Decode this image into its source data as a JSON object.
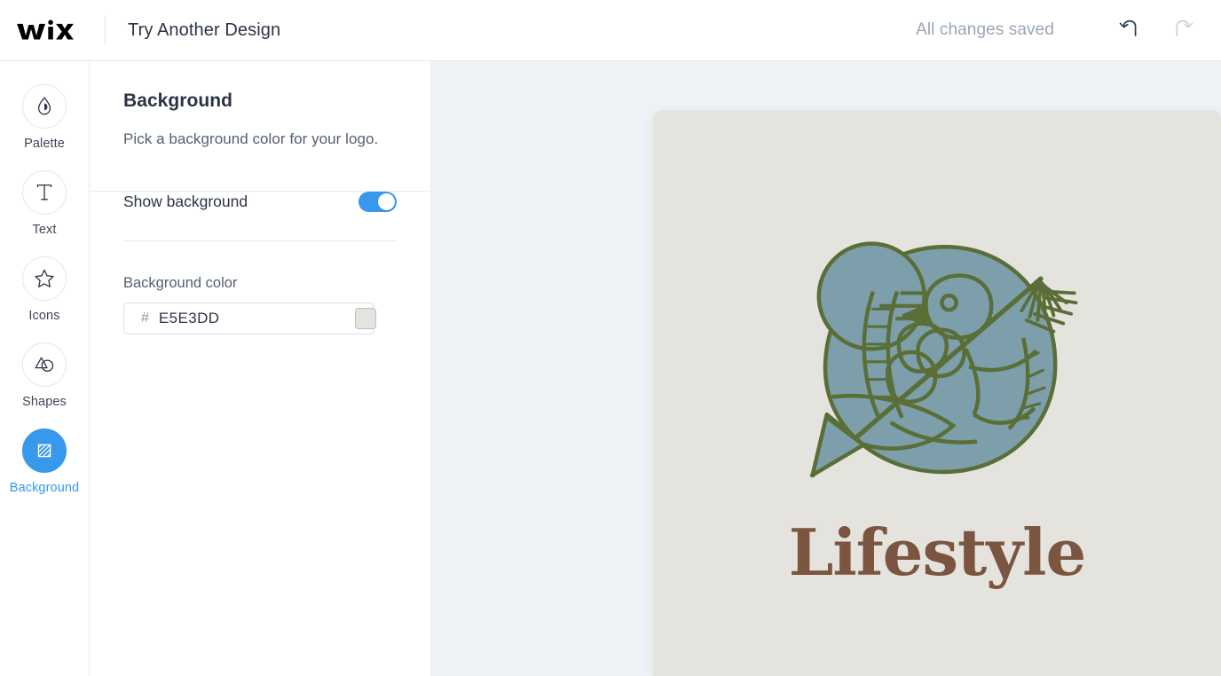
{
  "topbar": {
    "brand": "WiX",
    "title": "Try Another Design",
    "save_status": "All changes saved",
    "undo_label": "Undo",
    "redo_label": "Redo"
  },
  "sidebar": {
    "items": [
      {
        "id": "palette",
        "label": "Palette",
        "icon": "droplet-icon",
        "active": false
      },
      {
        "id": "text",
        "label": "Text",
        "icon": "text-t-icon",
        "active": false
      },
      {
        "id": "icons",
        "label": "Icons",
        "icon": "star-icon",
        "active": false
      },
      {
        "id": "shapes",
        "label": "Shapes",
        "icon": "shapes-icon",
        "active": false
      },
      {
        "id": "background",
        "label": "Background",
        "icon": "hatch-square-icon",
        "active": true
      }
    ],
    "active_color": "#3899ec"
  },
  "panel": {
    "title": "Background",
    "subtitle": "Pick a background color for your logo.",
    "show_background_label": "Show background",
    "show_background_on": true,
    "color_label": "Background color",
    "color_hash": "#",
    "color_value": "E5E3DD",
    "color_placeholder": "E5E3DD",
    "swatch_color": "#E5E3DD",
    "toggle_color": "#3899ec"
  },
  "canvas": {
    "background": "#eff3f7",
    "logo": {
      "card_color": "#E5E3DD",
      "brand_text": "Lifestyle",
      "text_color": "#7B5540",
      "mark_fill": "#7D9FAC",
      "mark_stroke": "#5A6E37"
    }
  }
}
